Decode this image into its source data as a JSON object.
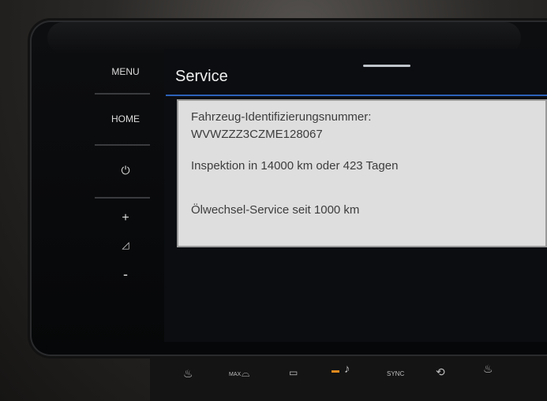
{
  "sidebar": {
    "menu_label": "MENU",
    "home_label": "HOME",
    "power_icon": "⏻",
    "plus_icon": "+",
    "volume_icon": "◿",
    "minus_icon": "-"
  },
  "screen": {
    "title": "Service",
    "panel": {
      "vin_label": "Fahrzeug-Identifizierungsnummer:",
      "vin_value": "WVWZZZ3CZME128067",
      "inspection": "Inspektion in 14000 km oder 423 Tagen",
      "oil_service": "Ölwechsel-Service seit 1000 km"
    }
  },
  "bottom_controls": {
    "seat_heat_icon": "seat-heat-icon",
    "max_defrost_label": "MAX",
    "defrost_icon": "windshield-defrost-icon",
    "rear_defrost_icon": "rear-defrost-icon",
    "seat_airflow_icon": "seat-airflow-icon",
    "sync_label": "SYNC",
    "recirculation_icon": "recirculation-icon",
    "passenger_seat_heat_icon": "passenger-seat-heat-icon"
  },
  "colors": {
    "accent_line": "#2c62b8",
    "panel_bg": "#dedede",
    "indicator": "#e08a1e"
  }
}
